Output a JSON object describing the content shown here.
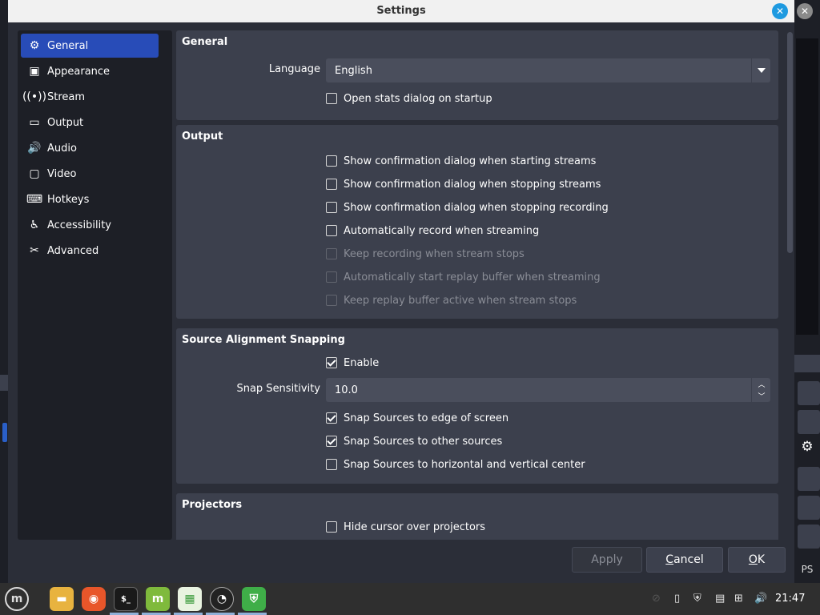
{
  "window": {
    "title": "Settings"
  },
  "sidebar": {
    "items": [
      {
        "label": "General",
        "icon": "gear-icon",
        "active": true
      },
      {
        "label": "Appearance",
        "icon": "appearance-icon"
      },
      {
        "label": "Stream",
        "icon": "antenna-icon"
      },
      {
        "label": "Output",
        "icon": "output-icon"
      },
      {
        "label": "Audio",
        "icon": "speaker-icon"
      },
      {
        "label": "Video",
        "icon": "monitor-icon"
      },
      {
        "label": "Hotkeys",
        "icon": "keyboard-icon"
      },
      {
        "label": "Accessibility",
        "icon": "accessibility-icon"
      },
      {
        "label": "Advanced",
        "icon": "tools-icon"
      }
    ]
  },
  "general": {
    "title": "General",
    "language_label": "Language",
    "language_value": "English",
    "stats_label": "Open stats dialog on startup"
  },
  "output": {
    "title": "Output",
    "opt1": "Show confirmation dialog when starting streams",
    "opt2": "Show confirmation dialog when stopping streams",
    "opt3": "Show confirmation dialog when stopping recording",
    "opt4": "Automatically record when streaming",
    "opt5": "Keep recording when stream stops",
    "opt6": "Automatically start replay buffer when streaming",
    "opt7": "Keep replay buffer active when stream stops"
  },
  "snapping": {
    "title": "Source Alignment Snapping",
    "enable_label": "Enable",
    "sensitivity_label": "Snap Sensitivity",
    "sensitivity_value": "10.0",
    "edge_label": "Snap Sources to edge of screen",
    "other_label": "Snap Sources to other sources",
    "center_label": "Snap Sources to horizontal and vertical center"
  },
  "projectors": {
    "title": "Projectors",
    "hide_cursor_label": "Hide cursor over projectors"
  },
  "buttons": {
    "apply": "Apply",
    "cancel_first": "C",
    "cancel_rest": "ancel",
    "ok_first": "O",
    "ok_rest": "K"
  },
  "background": {
    "ps_text": "PS"
  },
  "taskbar": {
    "clock": "21:47"
  },
  "colors": {
    "accent": "#284cb8",
    "panel": "#3c404d",
    "sidebar": "#1d1f26",
    "dialog_bg": "#2b2e38"
  }
}
